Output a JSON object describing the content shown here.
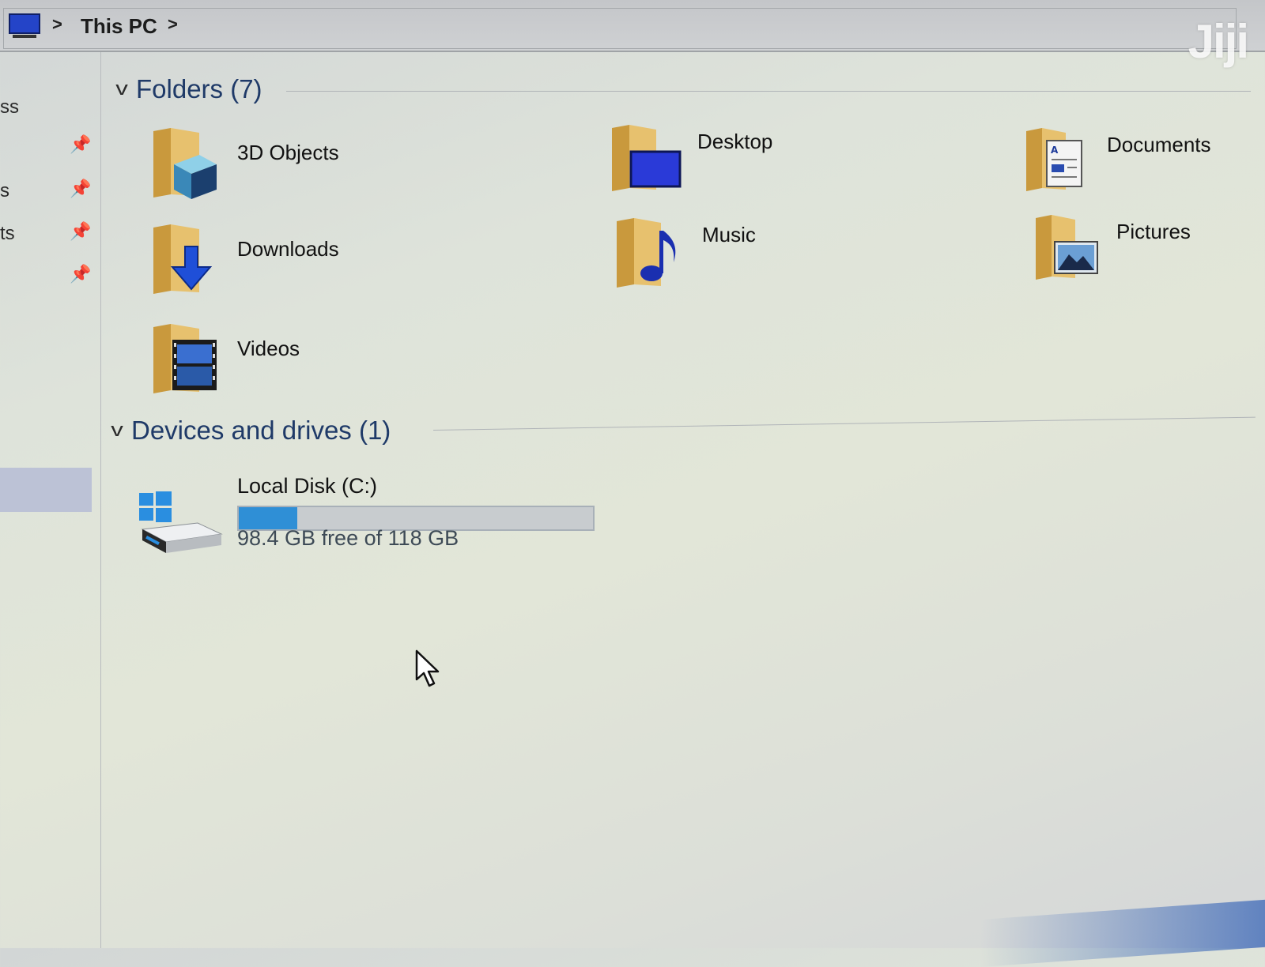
{
  "address_bar": {
    "location_icon": "this-pc-icon",
    "breadcrumb_sep": ">",
    "crumb": "This PC",
    "trailing_chevron": ">"
  },
  "watermark": "Jiji",
  "nav_pane": {
    "fragments": [
      "ss",
      "s",
      "ts"
    ],
    "pin_icon": "pin-icon"
  },
  "folders_group": {
    "title": "Folders (7)",
    "caret": "v",
    "items": [
      {
        "label": "3D Objects",
        "icon": "3d-objects-folder-icon"
      },
      {
        "label": "Desktop",
        "icon": "desktop-folder-icon"
      },
      {
        "label": "Documents",
        "icon": "documents-folder-icon"
      },
      {
        "label": "Downloads",
        "icon": "downloads-folder-icon"
      },
      {
        "label": "Music",
        "icon": "music-folder-icon"
      },
      {
        "label": "Pictures",
        "icon": "pictures-folder-icon"
      },
      {
        "label": "Videos",
        "icon": "videos-folder-icon"
      }
    ]
  },
  "drives_group": {
    "title": "Devices and drives (1)",
    "caret": "v",
    "drives": [
      {
        "name": "Local Disk (C:)",
        "free_text": "98.4 GB free of 118 GB",
        "used_fraction": 0.166,
        "icon": "windows-drive-icon"
      }
    ]
  },
  "colors": {
    "folder_yellow": "#e7c16e",
    "header_blue": "#1f3a68",
    "bar_fill": "#2f8fd6",
    "selection": "#bcc2d6"
  }
}
